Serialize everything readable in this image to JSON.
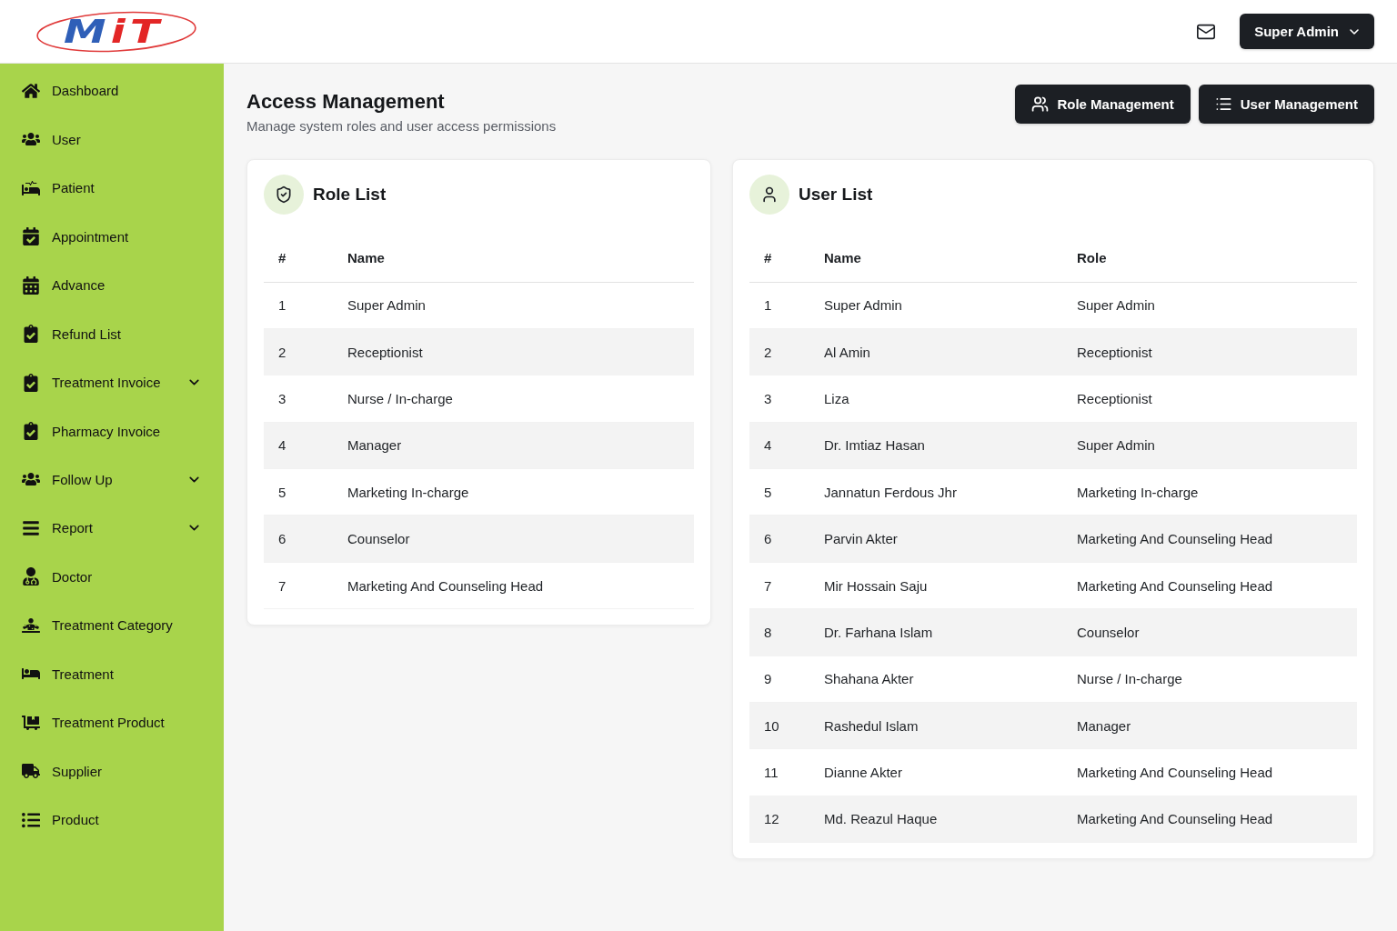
{
  "logo": {
    "letters": [
      "M",
      "i",
      "T"
    ]
  },
  "header": {
    "user_menu": {
      "label": "Super Admin"
    }
  },
  "sidebar": {
    "items": [
      {
        "label": "Dashboard",
        "expandable": false
      },
      {
        "label": "User",
        "expandable": false
      },
      {
        "label": "Patient",
        "expandable": false
      },
      {
        "label": "Appointment",
        "expandable": false
      },
      {
        "label": "Advance",
        "expandable": false
      },
      {
        "label": "Refund List",
        "expandable": false
      },
      {
        "label": "Treatment Invoice",
        "expandable": true
      },
      {
        "label": "Pharmacy Invoice",
        "expandable": false
      },
      {
        "label": "Follow Up",
        "expandable": true
      },
      {
        "label": "Report",
        "expandable": true
      },
      {
        "label": "Doctor",
        "expandable": false
      },
      {
        "label": "Treatment Category",
        "expandable": false
      },
      {
        "label": "Treatment",
        "expandable": false
      },
      {
        "label": "Treatment Product",
        "expandable": false
      },
      {
        "label": "Supplier",
        "expandable": false
      },
      {
        "label": "Product",
        "expandable": false
      }
    ]
  },
  "page": {
    "title": "Access Management",
    "subtitle": "Manage system roles and user access permissions",
    "actions": [
      {
        "label": "Role Management"
      },
      {
        "label": "User Management"
      }
    ]
  },
  "role_list": {
    "title": "Role List",
    "columns": [
      "#",
      "Name"
    ],
    "rows": [
      [
        "1",
        "Super Admin"
      ],
      [
        "2",
        "Receptionist"
      ],
      [
        "3",
        "Nurse / In-charge"
      ],
      [
        "4",
        "Manager"
      ],
      [
        "5",
        "Marketing In-charge"
      ],
      [
        "6",
        "Counselor"
      ],
      [
        "7",
        "Marketing And Counseling Head"
      ]
    ]
  },
  "user_list": {
    "title": "User List",
    "columns": [
      "#",
      "Name",
      "Role"
    ],
    "rows": [
      [
        "1",
        "Super Admin",
        "Super Admin"
      ],
      [
        "2",
        "Al Amin",
        "Receptionist"
      ],
      [
        "3",
        "Liza",
        "Receptionist"
      ],
      [
        "4",
        "Dr. Imtiaz Hasan",
        "Super Admin"
      ],
      [
        "5",
        "Jannatun Ferdous Jhr",
        "Marketing In-charge"
      ],
      [
        "6",
        "Parvin Akter",
        "Marketing And Counseling Head"
      ],
      [
        "7",
        "Mir Hossain Saju",
        "Marketing And Counseling Head"
      ],
      [
        "8",
        "Dr. Farhana Islam",
        "Counselor"
      ],
      [
        "9",
        "Shahana Akter",
        "Nurse / In-charge"
      ],
      [
        "10",
        "Rashedul Islam",
        "Manager"
      ],
      [
        "11",
        "Dianne Akter",
        "Marketing And Counseling Head"
      ],
      [
        "12",
        "Md. Reazul Haque",
        "Marketing And Counseling Head"
      ]
    ]
  }
}
